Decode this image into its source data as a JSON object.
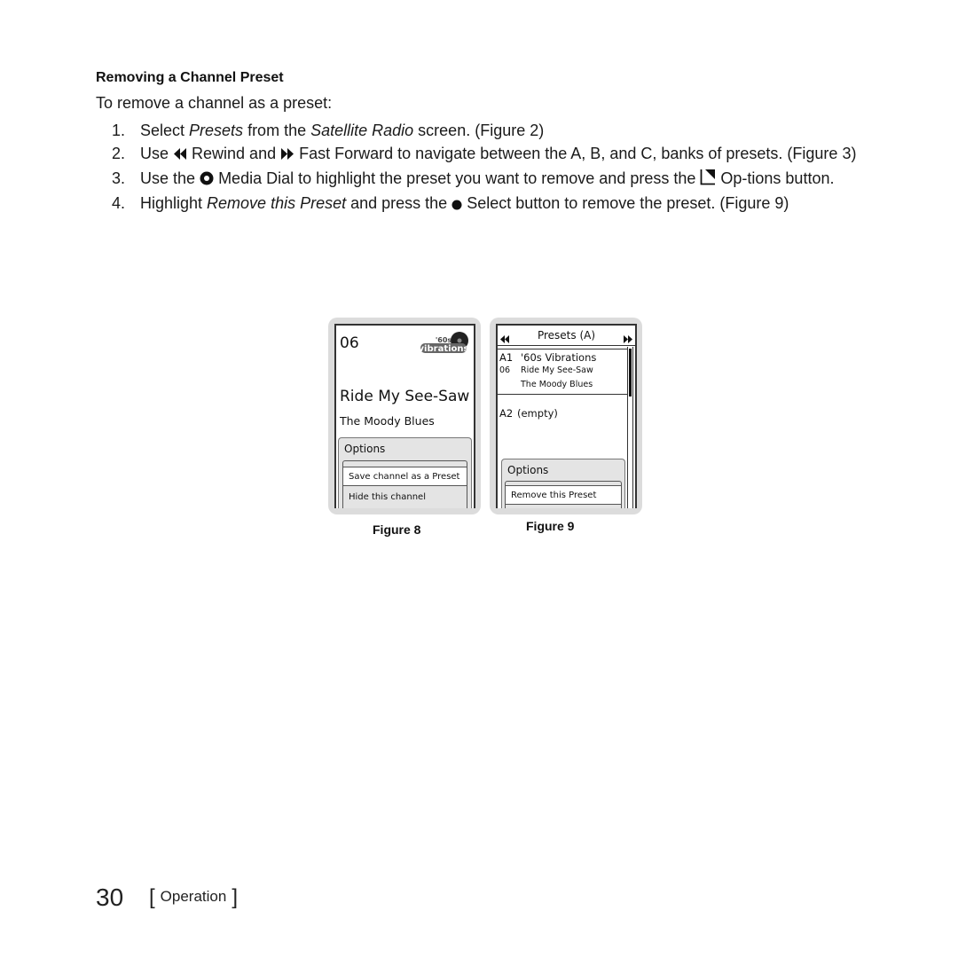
{
  "section": {
    "heading": "Removing a Channel Preset",
    "intro": "To remove a channel as a preset:"
  },
  "steps": [
    {
      "num": "1.",
      "parts": [
        "Select ",
        "Presets",
        " from the ",
        "Satellite Radio",
        " screen. (Figure 2)"
      ]
    },
    {
      "num": "2.",
      "parts": [
        "Use ",
        "Rewind and ",
        "Fast Forward to navigate between the A, B, and C, banks of presets. (Figure 3)"
      ],
      "icons": [
        "rewind-icon",
        "fast-forward-icon"
      ]
    },
    {
      "num": "3.",
      "parts": [
        "Use the ",
        "Media Dial to highlight the preset you want to remove and press the ",
        "Op-tions button."
      ],
      "icons": [
        "media-dial-icon",
        "options-button-icon"
      ]
    },
    {
      "num": "4.",
      "parts": [
        "Highlight ",
        "Remove this Preset",
        " and press the ",
        "Select button to remove the preset. (Figure 9)"
      ],
      "icons": [
        "select-button-icon"
      ]
    }
  ],
  "figure8": {
    "caption": "Figure 8",
    "channel_number": "06",
    "logo": "'60s Vibrations logo",
    "song": "Ride My See-Saw",
    "artist": "The Moody Blues",
    "options_title": "Options",
    "options": [
      "Save channel as a Preset",
      "Hide this channel"
    ],
    "selected_option": "Save channel as a Preset"
  },
  "figure9": {
    "caption": "Figure 9",
    "header_title": "Presets (A)",
    "header_icons": [
      "rewind-icon",
      "fast-forward-icon"
    ],
    "presets": [
      {
        "slot": "A1",
        "name": "'60s Vibrations",
        "channel": "06",
        "song": "Ride My See-Saw",
        "artist": "The Moody Blues"
      },
      {
        "slot": "A2",
        "name": "(empty)"
      }
    ],
    "options_title": "Options",
    "options": [
      "Remove this Preset"
    ],
    "selected_option": "Remove this Preset"
  },
  "footer": {
    "page_number": "30",
    "section_label": "Operation",
    "bracket_open": "[",
    "bracket_close": "]"
  }
}
